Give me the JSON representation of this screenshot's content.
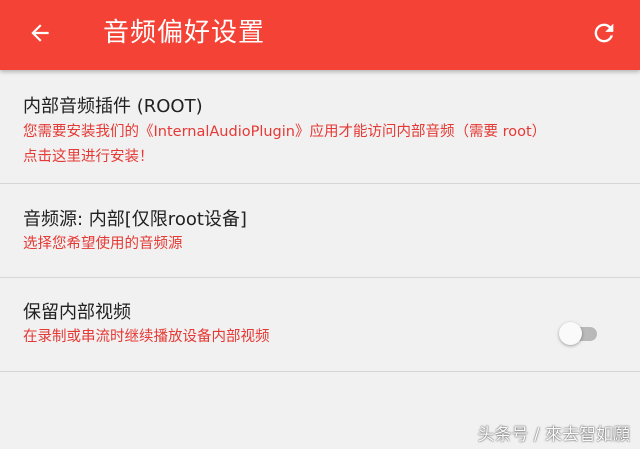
{
  "toolbar": {
    "title": "音频偏好设置",
    "back_icon": "arrow-left-icon",
    "refresh_icon": "refresh-icon",
    "background_color": "#f44336"
  },
  "preferences": [
    {
      "title": "内部音频插件 (ROOT)",
      "summary_lines": [
        "您需要安装我们的《InternalAudioPlugin》应用才能访问内部音频（需要 root）",
        "点击这里进行安装！"
      ]
    },
    {
      "title": "音频源: 内部[仅限root设备]",
      "summary_lines": [
        "选择您希望使用的音频源"
      ]
    },
    {
      "title": "保留内部视频",
      "summary_lines": [
        "在录制或串流时继续播放设备内部视频"
      ],
      "switch_on": false
    }
  ],
  "accent_color": "#e53935",
  "watermark": "头条号 / 來去智如願"
}
